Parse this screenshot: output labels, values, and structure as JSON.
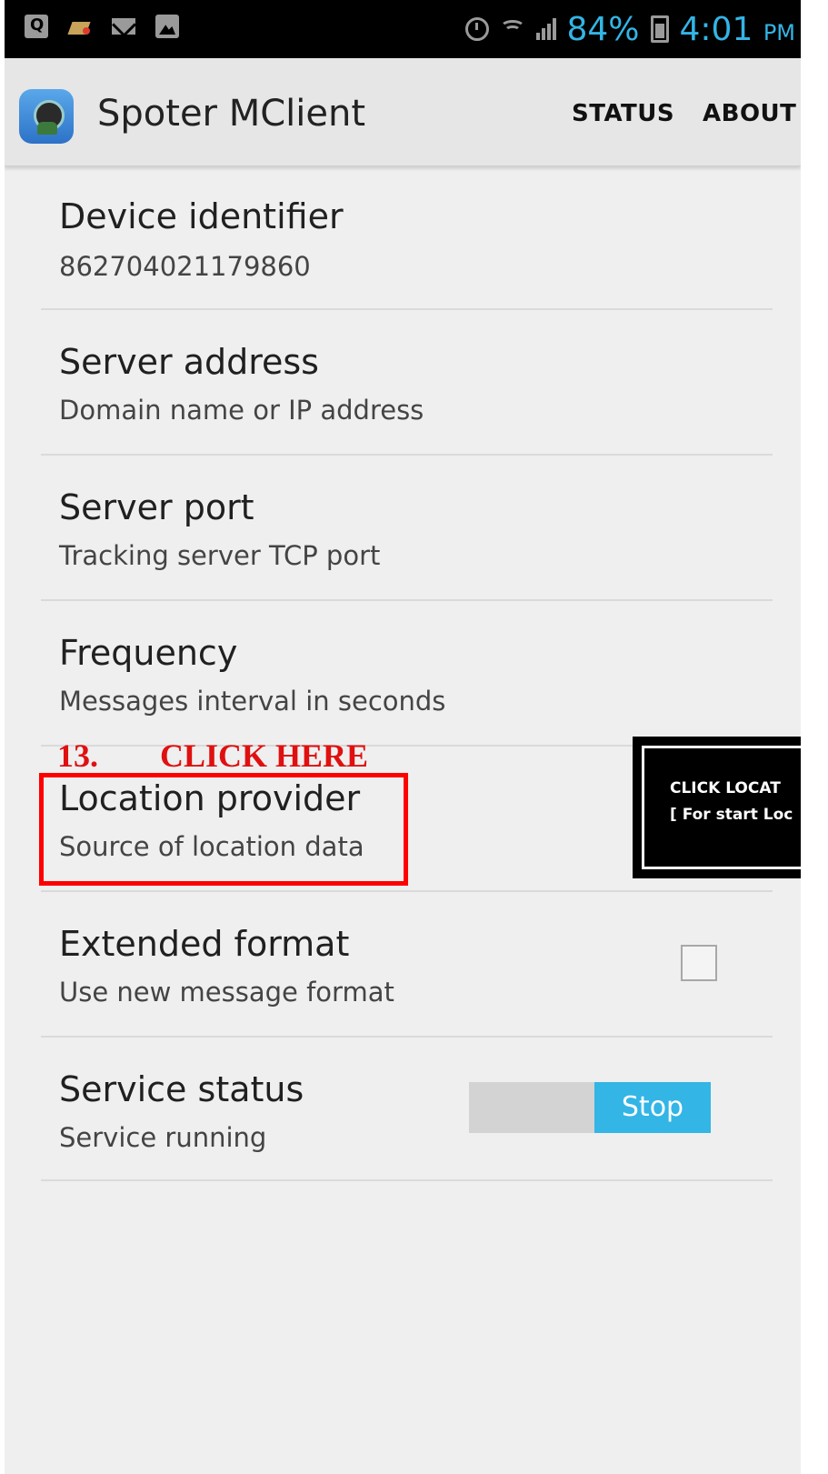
{
  "status_bar": {
    "left_icons": [
      "q-app-icon",
      "paint-brush-icon",
      "mail-icon",
      "image-icon"
    ],
    "alarm_icon": "alarm-icon",
    "wifi_icon": "wifi-icon",
    "signal_icon": "signal-icon",
    "battery_percent": "84%",
    "battery_icon": "battery-icon",
    "time": "4:01",
    "time_suffix": "PM"
  },
  "action_bar": {
    "app_icon": "spoter-app-icon",
    "title": "Spoter MClient",
    "status_label": "STATUS",
    "about_label": "ABOUT"
  },
  "prefs": [
    {
      "title": "Device identifier",
      "summary": "862704021179860"
    },
    {
      "title": "Server address",
      "summary": "Domain name or IP address"
    },
    {
      "title": "Server port",
      "summary": "Tracking server TCP port"
    },
    {
      "title": "Frequency",
      "summary": "Messages interval in seconds"
    },
    {
      "title": "Location provider",
      "summary": "Source of location data"
    },
    {
      "title": "Extended format",
      "summary": "Use new message format",
      "checked": false
    },
    {
      "title": "Service status",
      "summary": "Service running",
      "toggle_label": "Stop"
    }
  ],
  "annotation": {
    "step_number": "13.",
    "instruction": "CLICK HERE",
    "callout_line1": "CLICK  LOCAT",
    "callout_line2": "[ For start Loc"
  },
  "colors": {
    "accent": "#33b5e5",
    "annotation_red": "#ff0000"
  }
}
